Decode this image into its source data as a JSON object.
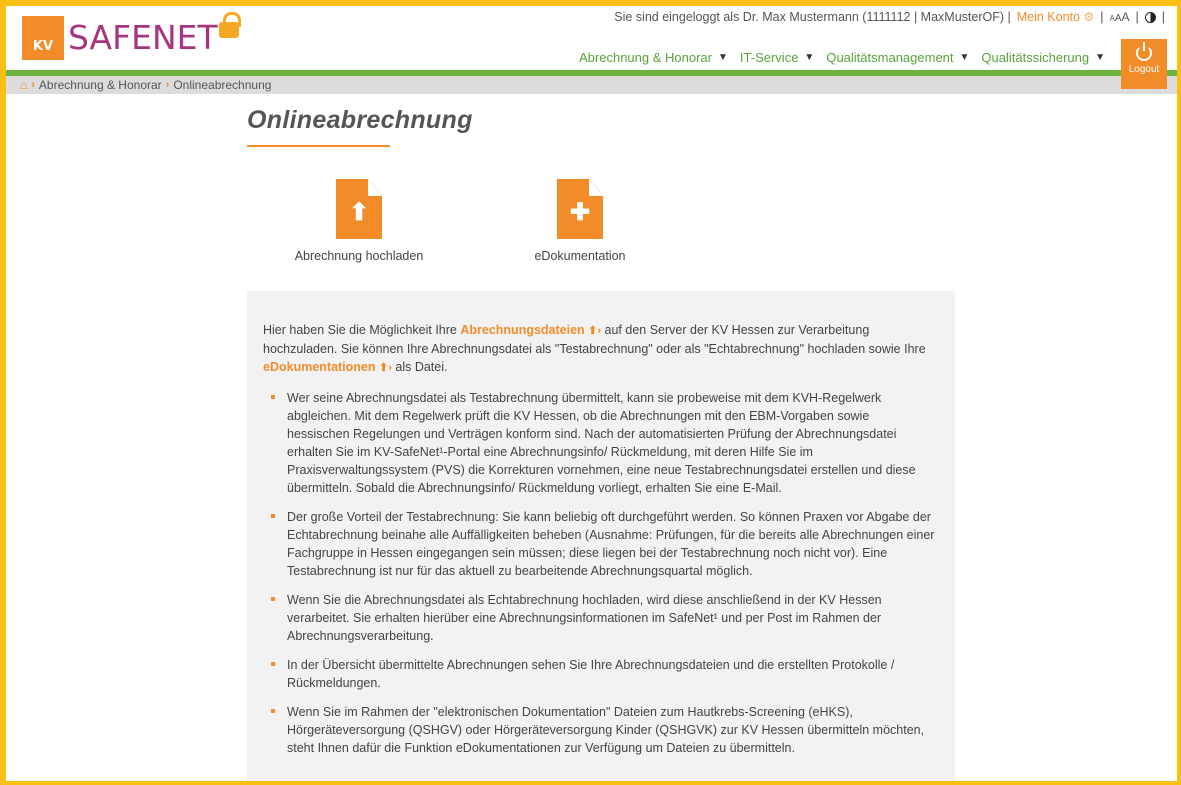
{
  "header": {
    "logo_kv": "KV",
    "logo_text": "SAFENET",
    "login_text": "Sie sind eingeloggt als Dr. Max Mustermann (1111112 | MaxMusterOF) |",
    "account_label": "Mein Konto",
    "font_size_label": "AAA",
    "separator": "|",
    "logout_label": "Logout"
  },
  "nav": {
    "items": [
      {
        "label": "Abrechnung & Honorar"
      },
      {
        "label": "IT-Service"
      },
      {
        "label": "Qualitätsmanagement"
      },
      {
        "label": "Qualitätssicherung"
      }
    ]
  },
  "breadcrumb": {
    "items": [
      "Abrechnung & Honorar",
      "Onlineabrechnung"
    ]
  },
  "page": {
    "title": "Onlineabrechnung",
    "tiles": [
      {
        "label": "Abrechnung hochladen",
        "icon": "file-upload-icon"
      },
      {
        "label": "eDokumentation",
        "icon": "file-plus-icon"
      }
    ]
  },
  "info": {
    "intro_1": "Hier haben Sie die Möglichkeit Ihre",
    "link_1": "Abrechnungsdateien",
    "intro_2": "auf den Server der KV Hessen zur Verarbeitung hochzuladen. Sie können Ihre Abrechnungsdatei als \"Testabrechnung\" oder als \"Echtabrechnung\" hochladen sowie Ihre",
    "link_2": "eDokumentationen",
    "intro_3": "als Datei.",
    "bullets": [
      "Wer seine Abrechnungsdatei als Testabrechnung übermittelt, kann sie probeweise mit dem KVH-Regelwerk abgleichen. Mit dem Regelwerk prüft die KV Hessen, ob die Abrechnungen mit den EBM-Vorgaben sowie hessischen Regelungen und Verträgen konform sind. Nach der automatisierten Prüfung der Abrechnungsdatei erhalten Sie im KV-SafeNet¹-Portal eine Abrechnungsinfo/ Rückmeldung, mit deren Hilfe Sie im Praxisverwaltungssystem (PVS) die Korrekturen vornehmen, eine neue Testabrechnungsdatei erstellen und diese übermitteln. Sobald die Abrechnungsinfo/ Rückmeldung vorliegt, erhalten Sie eine E-Mail.",
      "Der große Vorteil der Testabrechnung: Sie kann beliebig oft durchgeführt werden. So können Praxen vor Abgabe der Echtabrechnung beinahe alle Auffälligkeiten beheben (Ausnahme: Prüfungen, für die bereits alle Abrechnungen einer Fachgruppe in Hessen eingegangen sein müssen; diese liegen bei der Testabrechnung noch nicht vor). Eine Testabrechnung ist nur für das aktuell zu bearbeitende Abrechnungsquartal möglich.",
      "Wenn Sie die Abrechnungsdatei als Echtabrechnung hochladen, wird diese anschließend in der KV Hessen verarbeitet. Sie erhalten hierüber eine Abrechnungsinformationen im SafeNet¹ und per Post im Rahmen der Abrechnungsverarbeitung.",
      "In der Übersicht übermittelte Abrechnungen sehen Sie Ihre Abrechnungsdateien und die erstellten Protokolle / Rückmeldungen.",
      "Wenn Sie im Rahmen der \"elektronischen Dokumentation\" Dateien zum Hautkrebs-Screening (eHKS), Hörgeräteversorgung (QSHGV) oder Hörgeräteversorgung Kinder (QSHGVK) zur KV Hessen übermitteln möchten, steht Ihnen dafür die Funktion eDokumentationen zur Verfügung um Dateien zu übermitteln."
    ]
  },
  "colors": {
    "accent": "#f28c28",
    "brand": "#a6347e",
    "nav_green": "#6cb33f",
    "frame": "#f9c013"
  }
}
